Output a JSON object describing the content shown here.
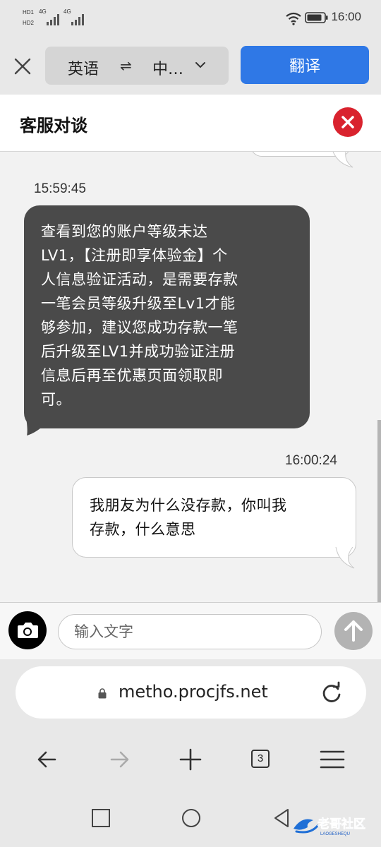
{
  "status_bar": {
    "sim1_label": "HD1",
    "sim2_label": "HD2",
    "sim1_net": "4G",
    "sim2_net": "4G",
    "time": "16:00",
    "icons": [
      "signal-icon",
      "wifi-icon",
      "battery-icon"
    ]
  },
  "translate_bar": {
    "source_lang": "英语",
    "swap_symbol": "⇌",
    "target_lang": "中…",
    "translate_label": "翻译"
  },
  "chat": {
    "title": "客服对谈",
    "messages": [
      {
        "sender": "agent",
        "timestamp": "15:59:45",
        "lines": [
          "查看到您的账户等级未达",
          "LV1，【注册即享体验金】个",
          "人信息验证活动，是需要存款",
          "一笔会员等级升级至Lv1才能",
          "够参加，建议您成功存款一笔",
          "后升级至LV1并成功验证注册",
          "信息后再至优惠页面领取即",
          "可。"
        ]
      },
      {
        "sender": "user",
        "timestamp": "16:00:24",
        "lines": [
          "我朋友为什么没存款，你叫我",
          "存款，什么意思"
        ]
      }
    ]
  },
  "input": {
    "placeholder": "输入文字",
    "value": ""
  },
  "browser": {
    "url": "metho.procjfs.net",
    "tab_count": "3"
  },
  "watermark": {
    "text": "老哥社区",
    "subtext": "LAOGESHEQU"
  },
  "colors": {
    "accent_blue": "#2f78e6",
    "close_red": "#d9232e",
    "agent_bubble": "#4a4a4a"
  }
}
